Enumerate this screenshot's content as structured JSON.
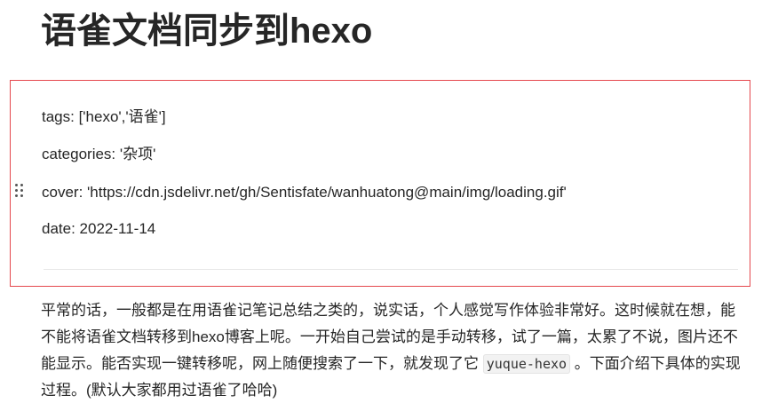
{
  "document": {
    "title": "语雀文档同步到hexo"
  },
  "frontmatter": {
    "tags": "tags: ['hexo','语雀']",
    "categories": "categories: '杂项'",
    "cover": "cover: 'https://cdn.jsdelivr.net/gh/Sentisfate/wanhuatong@main/img/loading.gif'",
    "date": "date: 2022-11-14"
  },
  "paragraph": {
    "text_before": "平常的话，一般都是在用语雀记笔记总结之类的，说实话，个人感觉写作体验非常好。这时候就在想，能不能将语雀文档转移到hexo博客上呢。一开始自己尝试的是手动转移，试了一篇，太累了不说，图片还不能显示。能否实现一键转移呢，网上随便搜索了一下，就发现了它 ",
    "code": "yuque-hexo",
    "text_after": " 。下面介绍下具体的实现过程。(默认大家都用过语雀了哈哈)"
  },
  "colors": {
    "selection_border": "#e5484d",
    "text": "#262626"
  },
  "icons": {
    "drag_handle": "drag-handle-icon"
  }
}
